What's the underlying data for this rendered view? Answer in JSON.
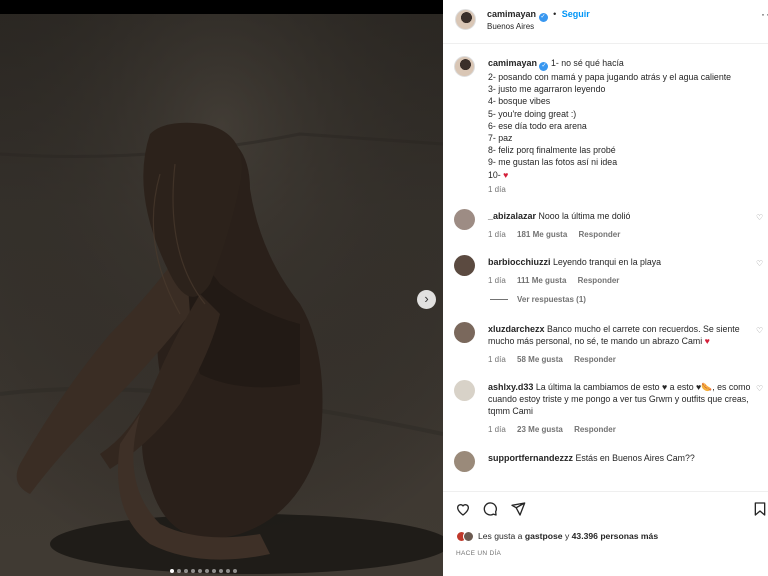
{
  "post": {
    "username": "camimayan",
    "follow_label": "Seguir",
    "location": "Buenos Aires",
    "more_label": "···",
    "next_label": "›"
  },
  "caption": {
    "username": "camimayan",
    "lines": [
      "1- no sé qué hacía",
      "2- posando con mamá y papa jugando atrás y el agua caliente",
      "3- justo me agarraron leyendo",
      "4- bosque vibes",
      "5- you're doing great :)",
      "6- ese día todo era arena",
      "7- paz",
      "8- feliz porq finalmente las probé",
      "9- me gustan las fotos así ni idea",
      "10- "
    ],
    "emoji": "♥",
    "time": "1 día"
  },
  "comments": [
    {
      "username": "_abizalazar",
      "text": "Nooo la última me dolió",
      "time": "1 día",
      "likes": "181 Me gusta",
      "reply": "Responder"
    },
    {
      "username": "barbiocchiuzzi",
      "text": "Leyendo tranqui en la playa",
      "time": "1 día",
      "likes": "111 Me gusta",
      "reply": "Responder"
    },
    {
      "username": "xluzdarchezx",
      "text": "Banco mucho el carrete con recuerdos. Se siente mucho más personal, no sé, te mando un abrazo Cami ",
      "time": "1 día",
      "likes": "58 Me gusta",
      "reply": "Responder"
    },
    {
      "username": "ashlxy.d33",
      "text": "La última la cambiamos de esto ♥ a esto ♥🌭, es como cuando estoy triste y me pongo a ver tus Grwm y outfits que creas, tqmm Cami",
      "time": "1 día",
      "likes": "23 Me gusta",
      "reply": "Responder"
    },
    {
      "username": "supportfernandezzz",
      "text": "Estás en Buenos Aires Cam??",
      "time": "",
      "likes": "",
      "reply": ""
    }
  ],
  "view_replies": "Ver respuestas (1)",
  "likes": {
    "prefix": "Les gusta a ",
    "user": "gastpose",
    "middle": " y ",
    "count": "43.396 personas más"
  },
  "posted_ago": "HACE UN DÍA",
  "carousel": {
    "count": 10,
    "active": 0
  }
}
